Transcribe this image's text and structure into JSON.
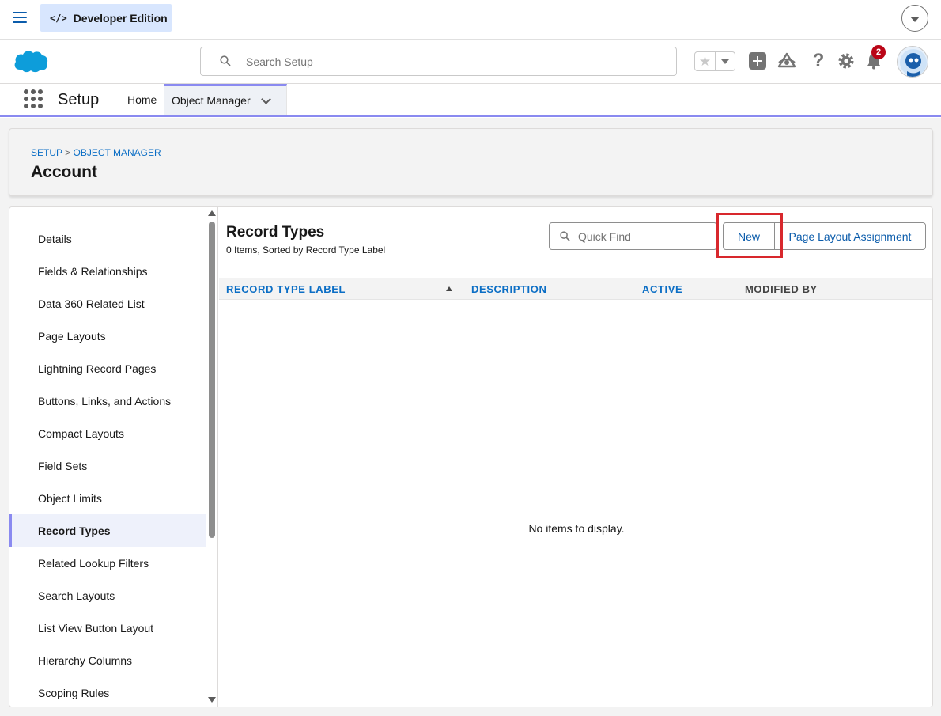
{
  "topbar": {
    "edition_label": "Developer Edition",
    "edition_icon": "code-icon",
    "edition_icon_glyph": "</>"
  },
  "header": {
    "search_placeholder": "Search Setup",
    "notification_count": "2",
    "help_glyph": "?"
  },
  "appnav": {
    "app_name": "Setup",
    "tabs": [
      {
        "label": "Home"
      },
      {
        "label": "Object Manager"
      }
    ]
  },
  "page_header": {
    "breadcrumb": {
      "setup": "SETUP",
      "separator": ">",
      "object_manager": "OBJECT MANAGER"
    },
    "title": "Account"
  },
  "sidebar": {
    "items": [
      {
        "label": "Details"
      },
      {
        "label": "Fields & Relationships"
      },
      {
        "label": "Data 360 Related List"
      },
      {
        "label": "Page Layouts"
      },
      {
        "label": "Lightning Record Pages"
      },
      {
        "label": "Buttons, Links, and Actions"
      },
      {
        "label": "Compact Layouts"
      },
      {
        "label": "Field Sets"
      },
      {
        "label": "Object Limits"
      },
      {
        "label": "Record Types"
      },
      {
        "label": "Related Lookup Filters"
      },
      {
        "label": "Search Layouts"
      },
      {
        "label": "List View Button Layout"
      },
      {
        "label": "Hierarchy Columns"
      },
      {
        "label": "Scoping Rules"
      }
    ],
    "active_index": 9
  },
  "content": {
    "title": "Record Types",
    "subtitle": "0 Items, Sorted by Record Type Label",
    "quick_find_placeholder": "Quick Find",
    "new_button": "New",
    "page_layout_button": "Page Layout Assignment",
    "columns": [
      "RECORD TYPE LABEL",
      "DESCRIPTION",
      "ACTIVE",
      "MODIFIED BY"
    ],
    "empty_message": "No items to display."
  },
  "colors": {
    "brand_blue": "#0b5cab",
    "link_blue": "#0b6ec5",
    "accent_purple": "#8a8af0",
    "highlight_red": "#d8282d",
    "badge_red": "#ba0517"
  }
}
